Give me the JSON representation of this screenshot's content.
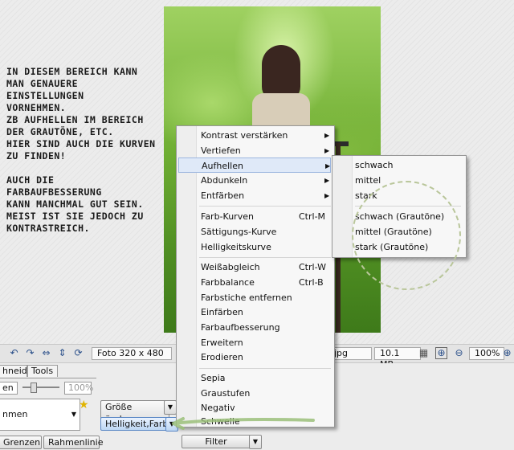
{
  "annotation": {
    "lines": [
      "IN DIESEM BEREICH KANN",
      "MAN GENAUERE",
      "EINSTELLUNGEN",
      "VORNEHMEN.",
      "ZB AUFHELLEN IM BEREICH",
      "DER GRAUTÖNE, ETC.",
      "HIER SIND AUCH DIE KURVEN",
      "ZU FINDEN!",
      "",
      "AUCH DIE",
      "FARBAUFBESSERUNG",
      "KANN MANCHMAL GUT SEIN.",
      "MEIST IST SIE JEDOCH ZU",
      "KONTRASTREICH."
    ]
  },
  "statusbar": {
    "photo_size": "Foto 320 x 480",
    "filename_fragment": "jpg",
    "file_size": "10.1 MB",
    "zoom": "100%"
  },
  "tabs": {
    "tab1": "hneiden",
    "tab2": "Tools"
  },
  "controls": {
    "field_left": "en",
    "zoom_percent": "100%",
    "preset_field": "nmen",
    "resize_button": "Größe ändern",
    "brightness_button": "Helligkeit,Farbe",
    "borders_button": "Grenzen",
    "frame_button": "Rahmenlinie",
    "filter_button": "Filter"
  },
  "menu": {
    "items": [
      {
        "label": "Kontrast verstärken",
        "shortcut": "",
        "submenu": true
      },
      {
        "label": "Vertiefen",
        "shortcut": "",
        "submenu": true
      },
      {
        "label": "Aufhellen",
        "shortcut": "",
        "submenu": true,
        "highlighted": true
      },
      {
        "label": "Abdunkeln",
        "shortcut": "",
        "submenu": true
      },
      {
        "label": "Entfärben",
        "shortcut": "",
        "submenu": true
      },
      {
        "label": "Farb-Kurven",
        "shortcut": "Ctrl-M",
        "submenu": false
      },
      {
        "label": "Sättigungs-Kurve",
        "shortcut": "",
        "submenu": false
      },
      {
        "label": "Helligkeitskurve",
        "shortcut": "",
        "submenu": false
      },
      {
        "label": "Weißabgleich",
        "shortcut": "Ctrl-W",
        "submenu": false
      },
      {
        "label": "Farbbalance",
        "shortcut": "Ctrl-B",
        "submenu": false
      },
      {
        "label": "Farbstiche entfernen",
        "shortcut": "",
        "submenu": false
      },
      {
        "label": "Einfärben",
        "shortcut": "",
        "submenu": false
      },
      {
        "label": "Farbaufbesserung",
        "shortcut": "",
        "submenu": false
      },
      {
        "label": "Erweitern",
        "shortcut": "",
        "submenu": false
      },
      {
        "label": "Erodieren",
        "shortcut": "",
        "submenu": false
      },
      {
        "label": "Sepia",
        "shortcut": "",
        "submenu": false
      },
      {
        "label": "Graustufen",
        "shortcut": "",
        "submenu": false
      },
      {
        "label": "Negativ",
        "shortcut": "",
        "submenu": false
      },
      {
        "label": "Schwelle",
        "shortcut": "",
        "submenu": false
      }
    ]
  },
  "submenu": {
    "items": [
      "schwach",
      "mittel",
      "stark",
      "schwach (Grautöne)",
      "mittel (Grautöne)",
      "stark (Grautöne)"
    ]
  },
  "colors": {
    "highlight": "#dfe9f8",
    "annotation_circle": "#b9c69a",
    "annotation_stroke": "#9bbf7a"
  }
}
